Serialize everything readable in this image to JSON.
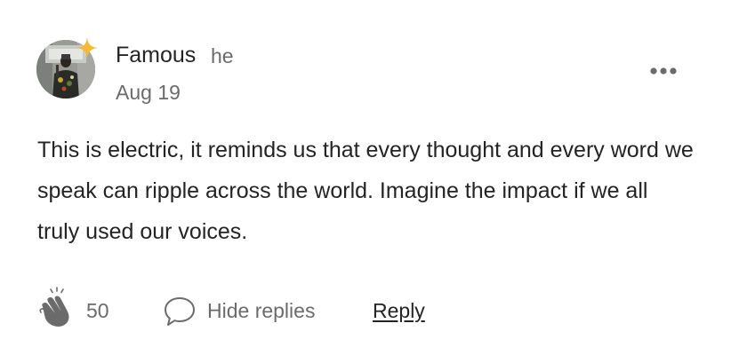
{
  "comment": {
    "author": {
      "name": "Famous",
      "pronoun": "he",
      "avatar_icon": "user-avatar-photo",
      "badge_icon": "sparkle-star-icon",
      "badge_color": "#f5b934"
    },
    "date": "Aug 19",
    "more_icon": "more-options-icon",
    "text": "This is electric, it reminds us that every thought and every word we speak can ripple across the world. Imagine the impact if we all truly used our voices.",
    "actions": {
      "clap_icon": "clap-hands-icon",
      "clap_count": "50",
      "replies_icon": "speech-bubble-icon",
      "replies_label": "Hide replies",
      "reply_label": "Reply"
    }
  },
  "colors": {
    "text_primary": "#242424",
    "text_secondary": "#6b6b6b",
    "background": "#ffffff"
  }
}
